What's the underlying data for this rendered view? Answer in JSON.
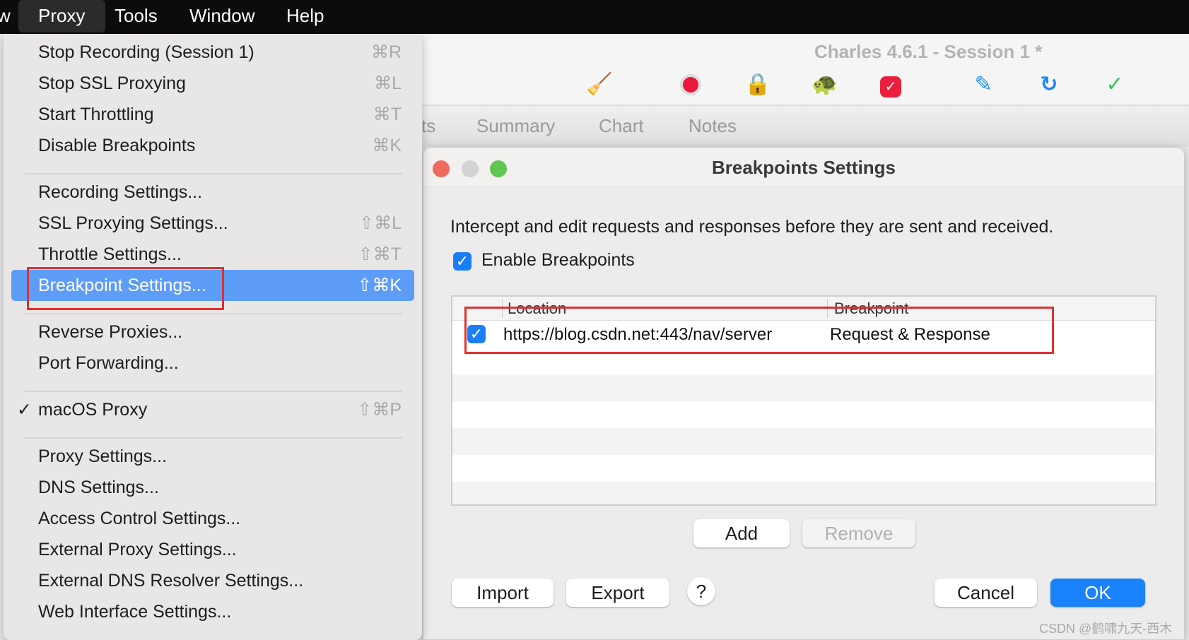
{
  "menubar": {
    "partial": "w",
    "items": [
      "Proxy",
      "Tools",
      "Window",
      "Help"
    ]
  },
  "window": {
    "title": "Charles 4.6.1 - Session 1 *",
    "toolbar_icons": [
      "broom-icon",
      "record-icon",
      "ssl-lock-icon",
      "throttle-turtle-icon",
      "breakpoint-stop-icon",
      "compose-pen-icon",
      "repeat-refresh-icon",
      "validate-check-icon"
    ],
    "tabs": [
      "ts",
      "Summary",
      "Chart",
      "Notes"
    ]
  },
  "proxy_menu": {
    "groups": [
      [
        {
          "label": "Stop Recording (Session 1)",
          "shortcut": "⌘R"
        },
        {
          "label": "Stop SSL Proxying",
          "shortcut": "⌘L"
        },
        {
          "label": "Start Throttling",
          "shortcut": "⌘T"
        },
        {
          "label": "Disable Breakpoints",
          "shortcut": "⌘K"
        }
      ],
      [
        {
          "label": "Recording Settings...",
          "shortcut": ""
        },
        {
          "label": "SSL Proxying Settings...",
          "shortcut": "⇧⌘L"
        },
        {
          "label": "Throttle Settings...",
          "shortcut": "⇧⌘T"
        },
        {
          "label": "Breakpoint Settings...",
          "shortcut": "⇧⌘K",
          "highlighted": true
        }
      ],
      [
        {
          "label": "Reverse Proxies...",
          "shortcut": ""
        },
        {
          "label": "Port Forwarding...",
          "shortcut": ""
        }
      ],
      [
        {
          "label": "macOS Proxy",
          "shortcut": "⇧⌘P",
          "checked": true
        }
      ],
      [
        {
          "label": "Proxy Settings...",
          "shortcut": ""
        },
        {
          "label": "DNS Settings...",
          "shortcut": ""
        },
        {
          "label": "Access Control Settings...",
          "shortcut": ""
        },
        {
          "label": "External Proxy Settings...",
          "shortcut": ""
        },
        {
          "label": "External DNS Resolver Settings...",
          "shortcut": ""
        },
        {
          "label": "Web Interface Settings...",
          "shortcut": ""
        }
      ]
    ]
  },
  "dialog": {
    "title": "Breakpoints Settings",
    "description": "Intercept and edit requests and responses before they are sent and received.",
    "enable_label": "Enable Breakpoints",
    "enabled": true,
    "columns": [
      "Location",
      "Breakpoint"
    ],
    "rows": [
      {
        "enabled": true,
        "location": "https://blog.csdn.net:443/nav/server",
        "breakpoint": "Request & Response"
      }
    ],
    "buttons": {
      "add": "Add",
      "remove": "Remove",
      "import": "Import",
      "export": "Export",
      "help": "?",
      "cancel": "Cancel",
      "ok": "OK"
    }
  },
  "watermark": "CSDN @鹤啸九天-西木",
  "colors": {
    "accent": "#1a7ef9",
    "menu_highlight": "#5d9cf7",
    "annotation": "#e03030"
  }
}
